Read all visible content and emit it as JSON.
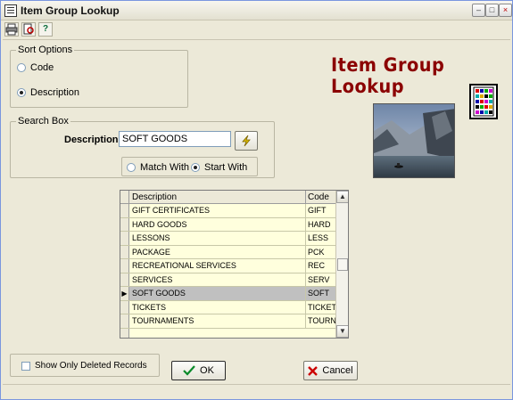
{
  "window": {
    "title": "Item Group Lookup"
  },
  "colors": {
    "title_red": "#8b0000",
    "grid_bg": "#ffffdd",
    "selected_row": "#c0c0c0",
    "window_bg": "#ece9d8"
  },
  "toolbar": {
    "icons": [
      "printer-icon",
      "preview-icon",
      "help-icon"
    ]
  },
  "sort_options": {
    "title": "Sort Options",
    "options": [
      {
        "label": "Code",
        "checked": false
      },
      {
        "label": "Description",
        "checked": true
      }
    ]
  },
  "header": {
    "title": "Item Group Lookup"
  },
  "search_box": {
    "title": "Search Box",
    "description_label": "Description",
    "description_value": "SOFT GOODS",
    "match_with_label": "Match With",
    "start_with_label": "Start With",
    "selected_mode": "Start With"
  },
  "grid": {
    "columns": [
      "Description",
      "Code"
    ],
    "rows": [
      {
        "description": "GIFT CERTIFICATES",
        "code": "GIFT"
      },
      {
        "description": "HARD GOODS",
        "code": "HARD"
      },
      {
        "description": "LESSONS",
        "code": "LESS"
      },
      {
        "description": "PACKAGE",
        "code": "PCK"
      },
      {
        "description": "RECREATIONAL SERVICES",
        "code": "REC"
      },
      {
        "description": "SERVICES",
        "code": "SERV"
      },
      {
        "description": "SOFT GOODS",
        "code": "SOFT",
        "selected": true
      },
      {
        "description": "TICKETS",
        "code": "TICKET"
      },
      {
        "description": "TOURNAMENTS",
        "code": "TOURN"
      }
    ]
  },
  "footer": {
    "show_deleted_label": "Show Only Deleted Records",
    "ok_label": "OK",
    "cancel_label": "Cancel"
  }
}
